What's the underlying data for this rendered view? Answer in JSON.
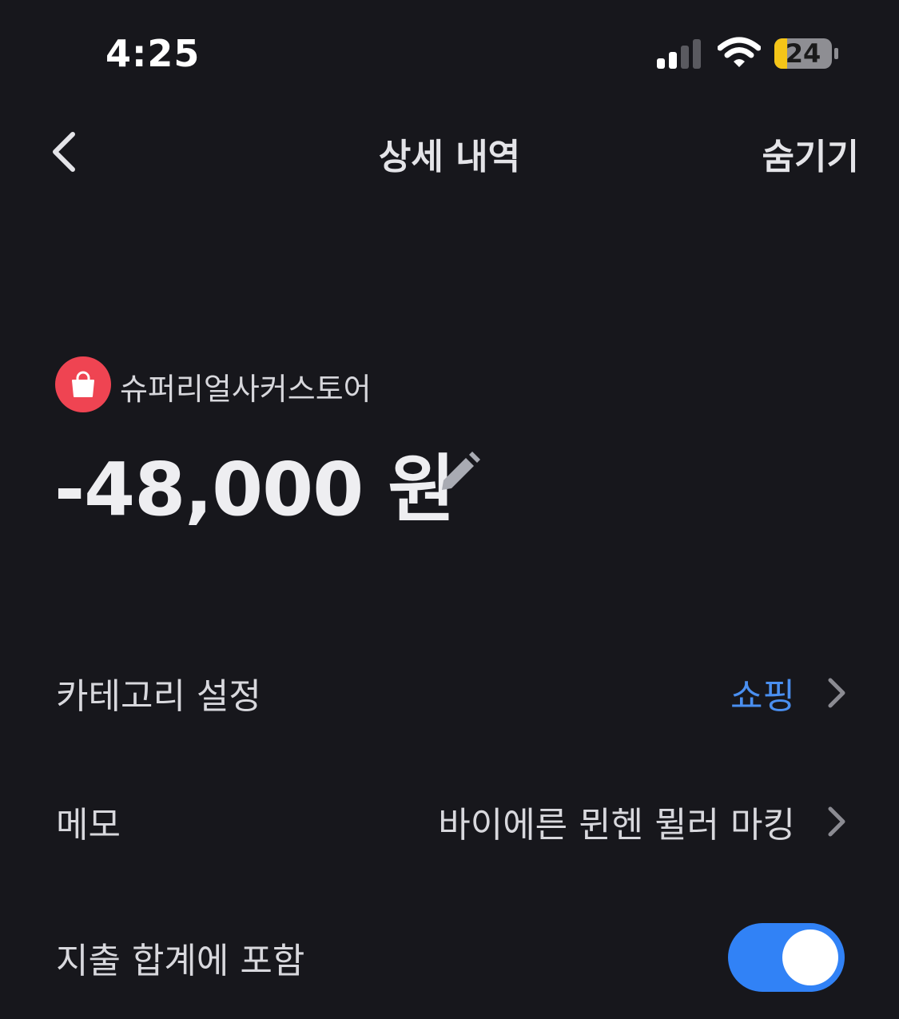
{
  "status_bar": {
    "time": "4:25",
    "battery_level": "24",
    "icons": [
      "signal-icon",
      "wifi-icon",
      "battery-icon"
    ],
    "battery_color": "#f5c518"
  },
  "header": {
    "back_icon": "chevron-left-icon",
    "title": "상세 내역",
    "hide_label": "숨기기"
  },
  "transaction": {
    "merchant_icon": "shopping-bag-icon",
    "merchant_icon_color": "#ef4452",
    "merchant_name": "슈퍼리얼사커스토어",
    "amount": "-48,000 원",
    "edit_icon": "pencil-icon"
  },
  "settings": {
    "category": {
      "label": "카테고리 설정",
      "value": "쇼핑",
      "value_color": "#4a8ff0"
    },
    "memo": {
      "label": "메모",
      "value": "바이에른 뮌헨 뮐러 마킹"
    },
    "include_in_total": {
      "label": "지출 합계에 포함",
      "enabled": true,
      "toggle_color": "#3182f6"
    }
  }
}
